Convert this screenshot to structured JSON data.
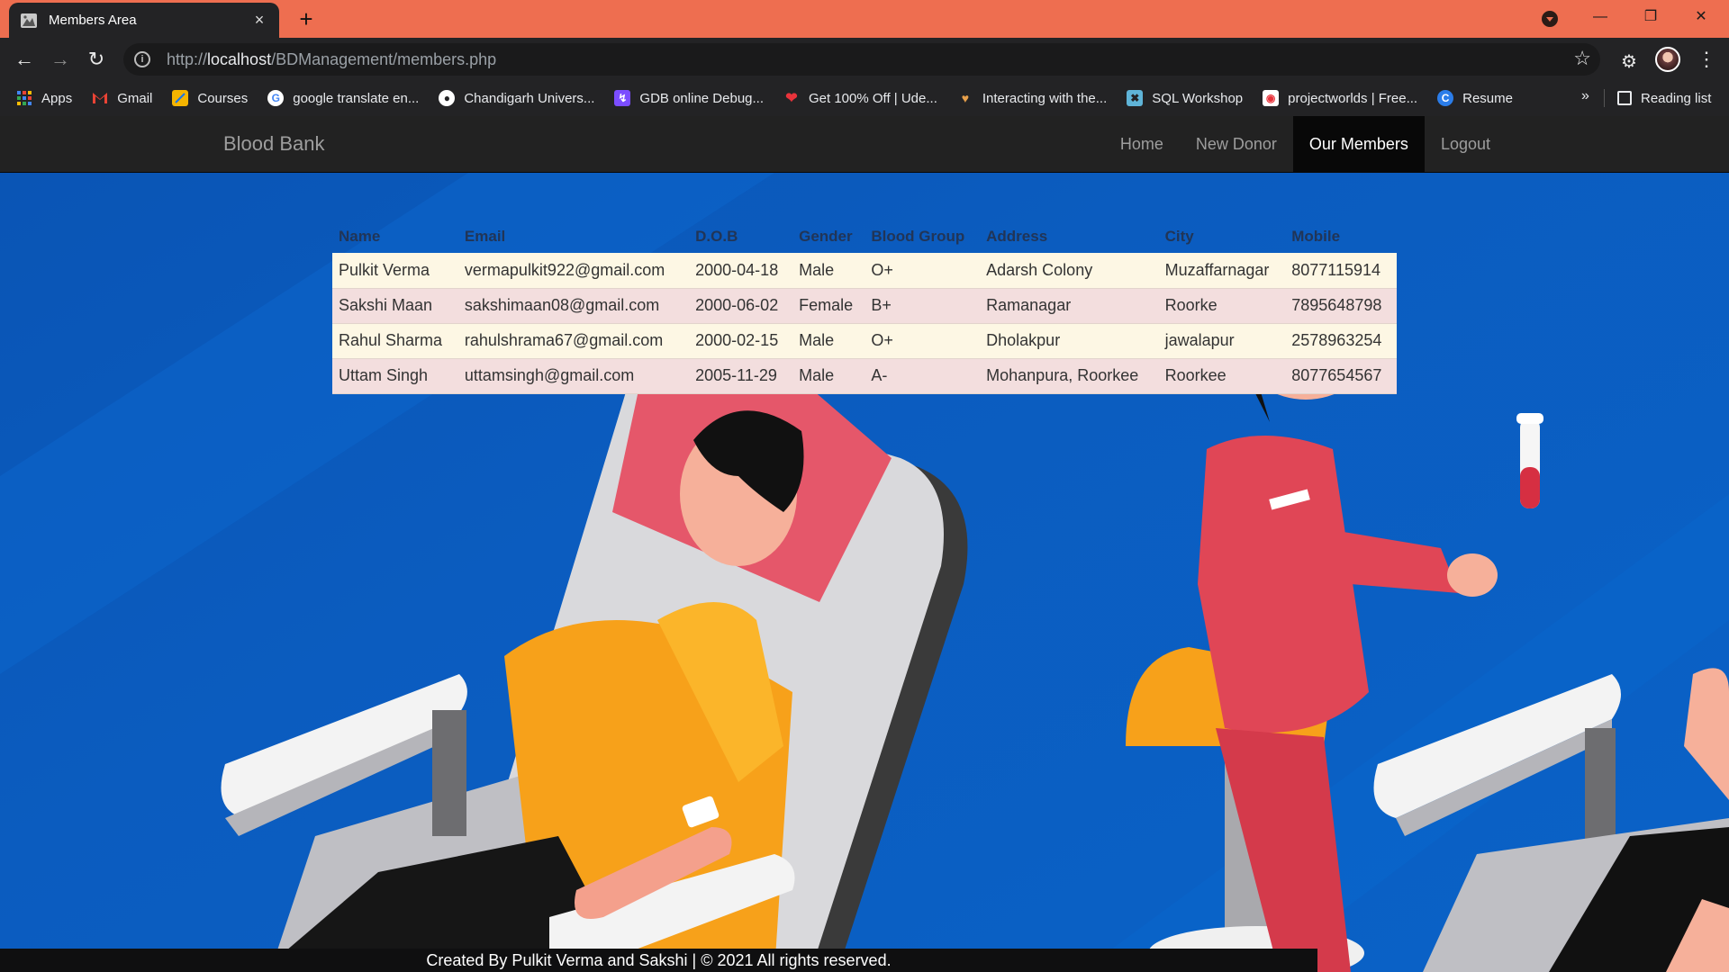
{
  "browser": {
    "tab_title": "Members Area",
    "tab_close": "×",
    "new_tab": "+",
    "url_prefix": "http://",
    "url_host": "localhost",
    "url_path": "/BDManagement/members.php",
    "bookmarks": [
      {
        "label": "Apps",
        "icon": "apps-grid-icon",
        "color": "#4285f4"
      },
      {
        "label": "Gmail",
        "icon": "gmail-icon",
        "color": "#ea4335"
      },
      {
        "label": "Courses",
        "icon": "courses-icon",
        "color": "#f4b400"
      },
      {
        "label": "google translate en...",
        "icon": "google-icon",
        "color": "#ffffff"
      },
      {
        "label": "Chandigarh Univers...",
        "icon": "globe-icon",
        "color": "#ffffff"
      },
      {
        "label": "GDB online Debug...",
        "icon": "gdb-icon",
        "color": "#7b4dff"
      },
      {
        "label": "Get 100% Off | Ude...",
        "icon": "udemy-heart-icon",
        "color": "#e8333b"
      },
      {
        "label": "Interacting with the...",
        "icon": "handshake-icon",
        "color": "#e8a04b"
      },
      {
        "label": "SQL Workshop",
        "icon": "sql-workshop-icon",
        "color": "#5fb4d8"
      },
      {
        "label": "projectworlds | Free...",
        "icon": "projectworlds-icon",
        "color": "#ffffff"
      },
      {
        "label": "Resume",
        "icon": "resume-icon",
        "color": "#2b7de9"
      }
    ],
    "bookmarks_more": "»",
    "reading_list": "Reading list"
  },
  "navbar": {
    "brand": "Blood Bank",
    "links": [
      {
        "label": "Home",
        "active": false
      },
      {
        "label": "New Donor",
        "active": false
      },
      {
        "label": "Our Members",
        "active": true
      },
      {
        "label": "Logout",
        "active": false
      }
    ]
  },
  "members_table": {
    "headers": [
      "Name",
      "Email",
      "D.O.B",
      "Gender",
      "Blood Group",
      "Address",
      "City",
      "Mobile"
    ],
    "rows": [
      [
        "Pulkit Verma",
        "vermapulkit922@gmail.com",
        "2000-04-18",
        "Male",
        "O+",
        "Adarsh Colony",
        "Muzaffarnagar",
        "8077115914"
      ],
      [
        "Sakshi Maan",
        "sakshimaan08@gmail.com",
        "2000-06-02",
        "Female",
        "B+",
        "Ramanagar",
        "Roorke",
        "7895648798"
      ],
      [
        "Rahul Sharma",
        "rahulshrama67@gmail.com",
        "2000-02-15",
        "Male",
        "O+",
        "Dholakpur",
        "jawalapur",
        "2578963254"
      ],
      [
        "Uttam Singh",
        "uttamsingh@gmail.com",
        "2005-11-29",
        "Male",
        "A-",
        "Mohanpura, Roorkee",
        "Roorkee",
        "8077654567"
      ]
    ]
  },
  "footer": {
    "text": "Created By Pulkit Verma and Sakshi | © 2021 All rights reserved."
  }
}
